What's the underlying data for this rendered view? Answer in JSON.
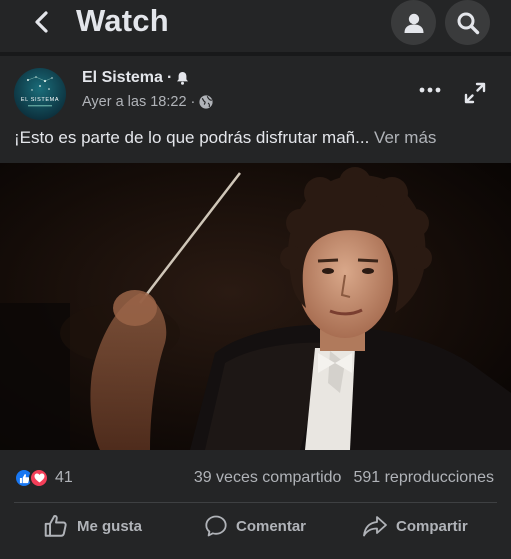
{
  "header": {
    "title": "Watch",
    "back_icon": "chevron-left-icon",
    "profile_icon": "person-icon",
    "search_icon": "search-icon"
  },
  "post": {
    "page_name": "El Sistema",
    "avatar_text": "EL SISTEMA",
    "timestamp": "Ayer a las 18:22",
    "caption": "¡Esto es parte de lo que podrás disfrutar mañ...",
    "see_more": "Ver más"
  },
  "stats": {
    "reaction_count": "41",
    "shares": "39 veces compartido",
    "views": "591 reproducciones"
  },
  "actions": {
    "like": "Me gusta",
    "comment": "Comentar",
    "share": "Compartir"
  },
  "colors": {
    "background": "#18191a",
    "card": "#242526",
    "primary_text": "#e4e6eb",
    "secondary_text": "#b0b3b8",
    "like_blue": "#1877f2",
    "love_red": "#f33e58"
  }
}
